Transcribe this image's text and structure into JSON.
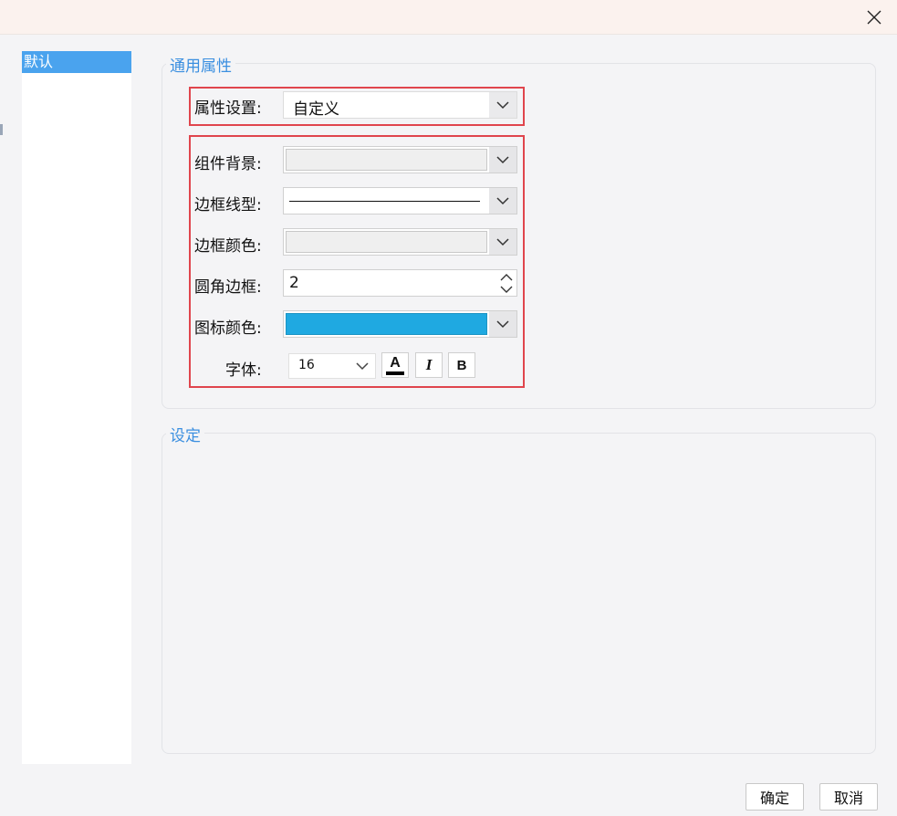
{
  "window": {
    "close_icon": "close-icon"
  },
  "sidebar": {
    "items": [
      {
        "label": "默认",
        "selected": true
      }
    ]
  },
  "general": {
    "legend": "通用属性",
    "property_setting": {
      "label": "属性设置:",
      "value": "自定义"
    },
    "component_background": {
      "label": "组件背景:",
      "value": ""
    },
    "border_line_type": {
      "label": "边框线型:",
      "value": "solid"
    },
    "border_color": {
      "label": "边框颜色:",
      "value": ""
    },
    "corner_radius": {
      "label": "圆角边框:",
      "value": "2"
    },
    "icon_color": {
      "label": "图标颜色:",
      "value": "#1fa9e1"
    },
    "font": {
      "label": "字体:",
      "size": "16",
      "color_button": "A",
      "italic_button": "I",
      "bold_button": "B"
    }
  },
  "settings": {
    "legend": "设定"
  },
  "footer": {
    "ok_label": "确定",
    "cancel_label": "取消"
  },
  "colors": {
    "accent": "#3b8fe0",
    "highlight_border": "#e0454d",
    "selected_item": "#4aa3ee",
    "icon_color_swatch": "#1fa9e1"
  }
}
